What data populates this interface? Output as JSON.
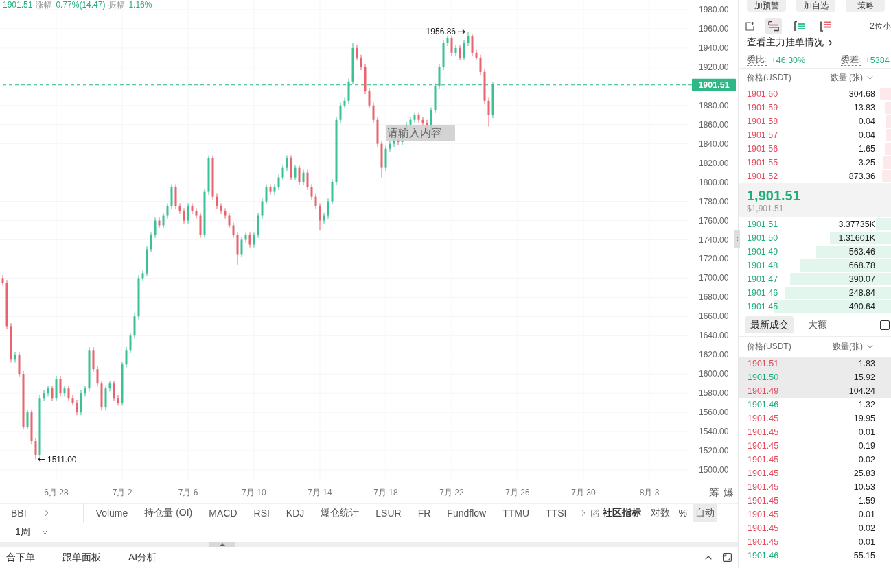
{
  "chart": {
    "stats": {
      "price": "1901.51",
      "items": [
        {
          "label": "涨幅",
          "value": "0.77%(14.47)"
        },
        {
          "label": "振幅",
          "value": "1.16%"
        }
      ]
    },
    "note_input": {
      "placeholder": "请输入内容"
    },
    "axis_tools": [
      "筹",
      "爆"
    ],
    "price_axis_labels": [
      "1980.00",
      "1960.00",
      "1940.00",
      "1920.00",
      "1880.00",
      "1860.00",
      "1840.00",
      "1820.00",
      "1800.00",
      "1780.00",
      "1760.00",
      "1740.00",
      "1720.00",
      "1700.00",
      "1680.00",
      "1660.00",
      "1640.00",
      "1620.00",
      "1600.00",
      "1580.00",
      "1560.00",
      "1540.00",
      "1520.00",
      "1500.00"
    ],
    "date_axis_labels": [
      "6月 28",
      "7月 2",
      "7月 6",
      "7月 10",
      "7月 14",
      "7月 18",
      "7月 22",
      "7月 26",
      "7月 30",
      "8月 3"
    ],
    "high_marker": "1956.86",
    "low_marker": "1511.00",
    "last_price_tag": "1901.51"
  },
  "indicator_bar": {
    "main_indicators": [
      "BBI"
    ],
    "sub_indicators": [
      "Volume",
      "持仓量 (OI)",
      "MACD",
      "RSI",
      "KDJ",
      "爆仓统计",
      "LSUR",
      "FR",
      "Fundflow",
      "TTMU",
      "TTSI"
    ],
    "community": "社区指标",
    "scale_modes": [
      {
        "label": "对数",
        "selected": false
      },
      {
        "label": "%",
        "selected": false
      },
      {
        "label": "自动",
        "selected": true
      }
    ]
  },
  "interval_tags": [
    {
      "label": "1周"
    }
  ],
  "bottom_tabs": [
    "合下单",
    "跟单面板",
    "AI分析"
  ],
  "side_panel": {
    "actions": [
      "加预警",
      "加自选",
      "策略"
    ],
    "view_modes": [
      {
        "kind": "both",
        "selected": true
      },
      {
        "kind": "bids",
        "selected": false
      },
      {
        "kind": "asks",
        "selected": false
      }
    ],
    "precision": "2位小",
    "depth_link": "查看主力挂单情况",
    "ratio": {
      "label": "委比:",
      "value": "+46.30%"
    },
    "diff": {
      "label": "委差:",
      "value": "+5384"
    },
    "book_columns": [
      "价格(USDT)",
      "数量 (张)"
    ],
    "asks": [
      {
        "price": "1901.60",
        "amount": "304.68",
        "level": 0.07
      },
      {
        "price": "1901.59",
        "amount": "13.83",
        "level": 0.04
      },
      {
        "price": "1901.58",
        "amount": "0.04",
        "level": 0.03
      },
      {
        "price": "1901.57",
        "amount": "0.04",
        "level": 0.03
      },
      {
        "price": "1901.56",
        "amount": "1.65",
        "level": 0.04
      },
      {
        "price": "1901.55",
        "amount": "3.25",
        "level": 0.05
      },
      {
        "price": "1901.52",
        "amount": "873.36",
        "level": 0.06
      }
    ],
    "last_price": "1,901.51",
    "last_price_usd": "$1,901.51",
    "bids": [
      {
        "price": "1901.51",
        "amount": "3.37735K",
        "level": 0.1
      },
      {
        "price": "1901.50",
        "amount": "1.31601K",
        "level": 0.4
      },
      {
        "price": "1901.49",
        "amount": "563.46",
        "level": 0.49
      },
      {
        "price": "1901.48",
        "amount": "668.78",
        "level": 0.6
      },
      {
        "price": "1901.47",
        "amount": "390.07",
        "level": 0.66
      },
      {
        "price": "1901.46",
        "amount": "248.84",
        "level": 0.7
      },
      {
        "price": "1901.45",
        "amount": "490.64",
        "level": 0.77
      }
    ],
    "trade_tabs": [
      {
        "label": "最新成交",
        "selected": true
      },
      {
        "label": "大额",
        "selected": false
      }
    ],
    "large_only": {
      "checked": false
    },
    "trade_columns": [
      "价格(USDT)",
      "数量(张)"
    ],
    "trades": [
      {
        "price": "1901.51",
        "amount": "1.83",
        "color": "#e34a5c",
        "highlighted": true
      },
      {
        "price": "1901.50",
        "amount": "15.92",
        "color": "#1fae78",
        "highlighted": true
      },
      {
        "price": "1901.49",
        "amount": "104.24",
        "color": "#e34a5c",
        "highlighted": true
      },
      {
        "price": "1901.46",
        "amount": "1.32",
        "color": "#1fae78",
        "highlighted": false
      },
      {
        "price": "1901.45",
        "amount": "19.95",
        "color": "#e34a5c",
        "highlighted": false
      },
      {
        "price": "1901.45",
        "amount": "0.01",
        "color": "#e34a5c",
        "highlighted": false
      },
      {
        "price": "1901.45",
        "amount": "0.19",
        "color": "#e34a5c",
        "highlighted": false
      },
      {
        "price": "1901.45",
        "amount": "0.02",
        "color": "#e34a5c",
        "highlighted": false
      },
      {
        "price": "1901.45",
        "amount": "25.83",
        "color": "#e34a5c",
        "highlighted": false
      },
      {
        "price": "1901.45",
        "amount": "10.53",
        "color": "#e34a5c",
        "highlighted": false
      },
      {
        "price": "1901.45",
        "amount": "1.59",
        "color": "#e34a5c",
        "highlighted": false
      },
      {
        "price": "1901.45",
        "amount": "0.01",
        "color": "#e34a5c",
        "highlighted": false
      },
      {
        "price": "1901.45",
        "amount": "0.02",
        "color": "#e34a5c",
        "highlighted": false
      },
      {
        "price": "1901.45",
        "amount": "0.01",
        "color": "#e34a5c",
        "highlighted": false
      },
      {
        "price": "1901.46",
        "amount": "55.15",
        "color": "#1fae78",
        "highlighted": false
      }
    ]
  }
}
